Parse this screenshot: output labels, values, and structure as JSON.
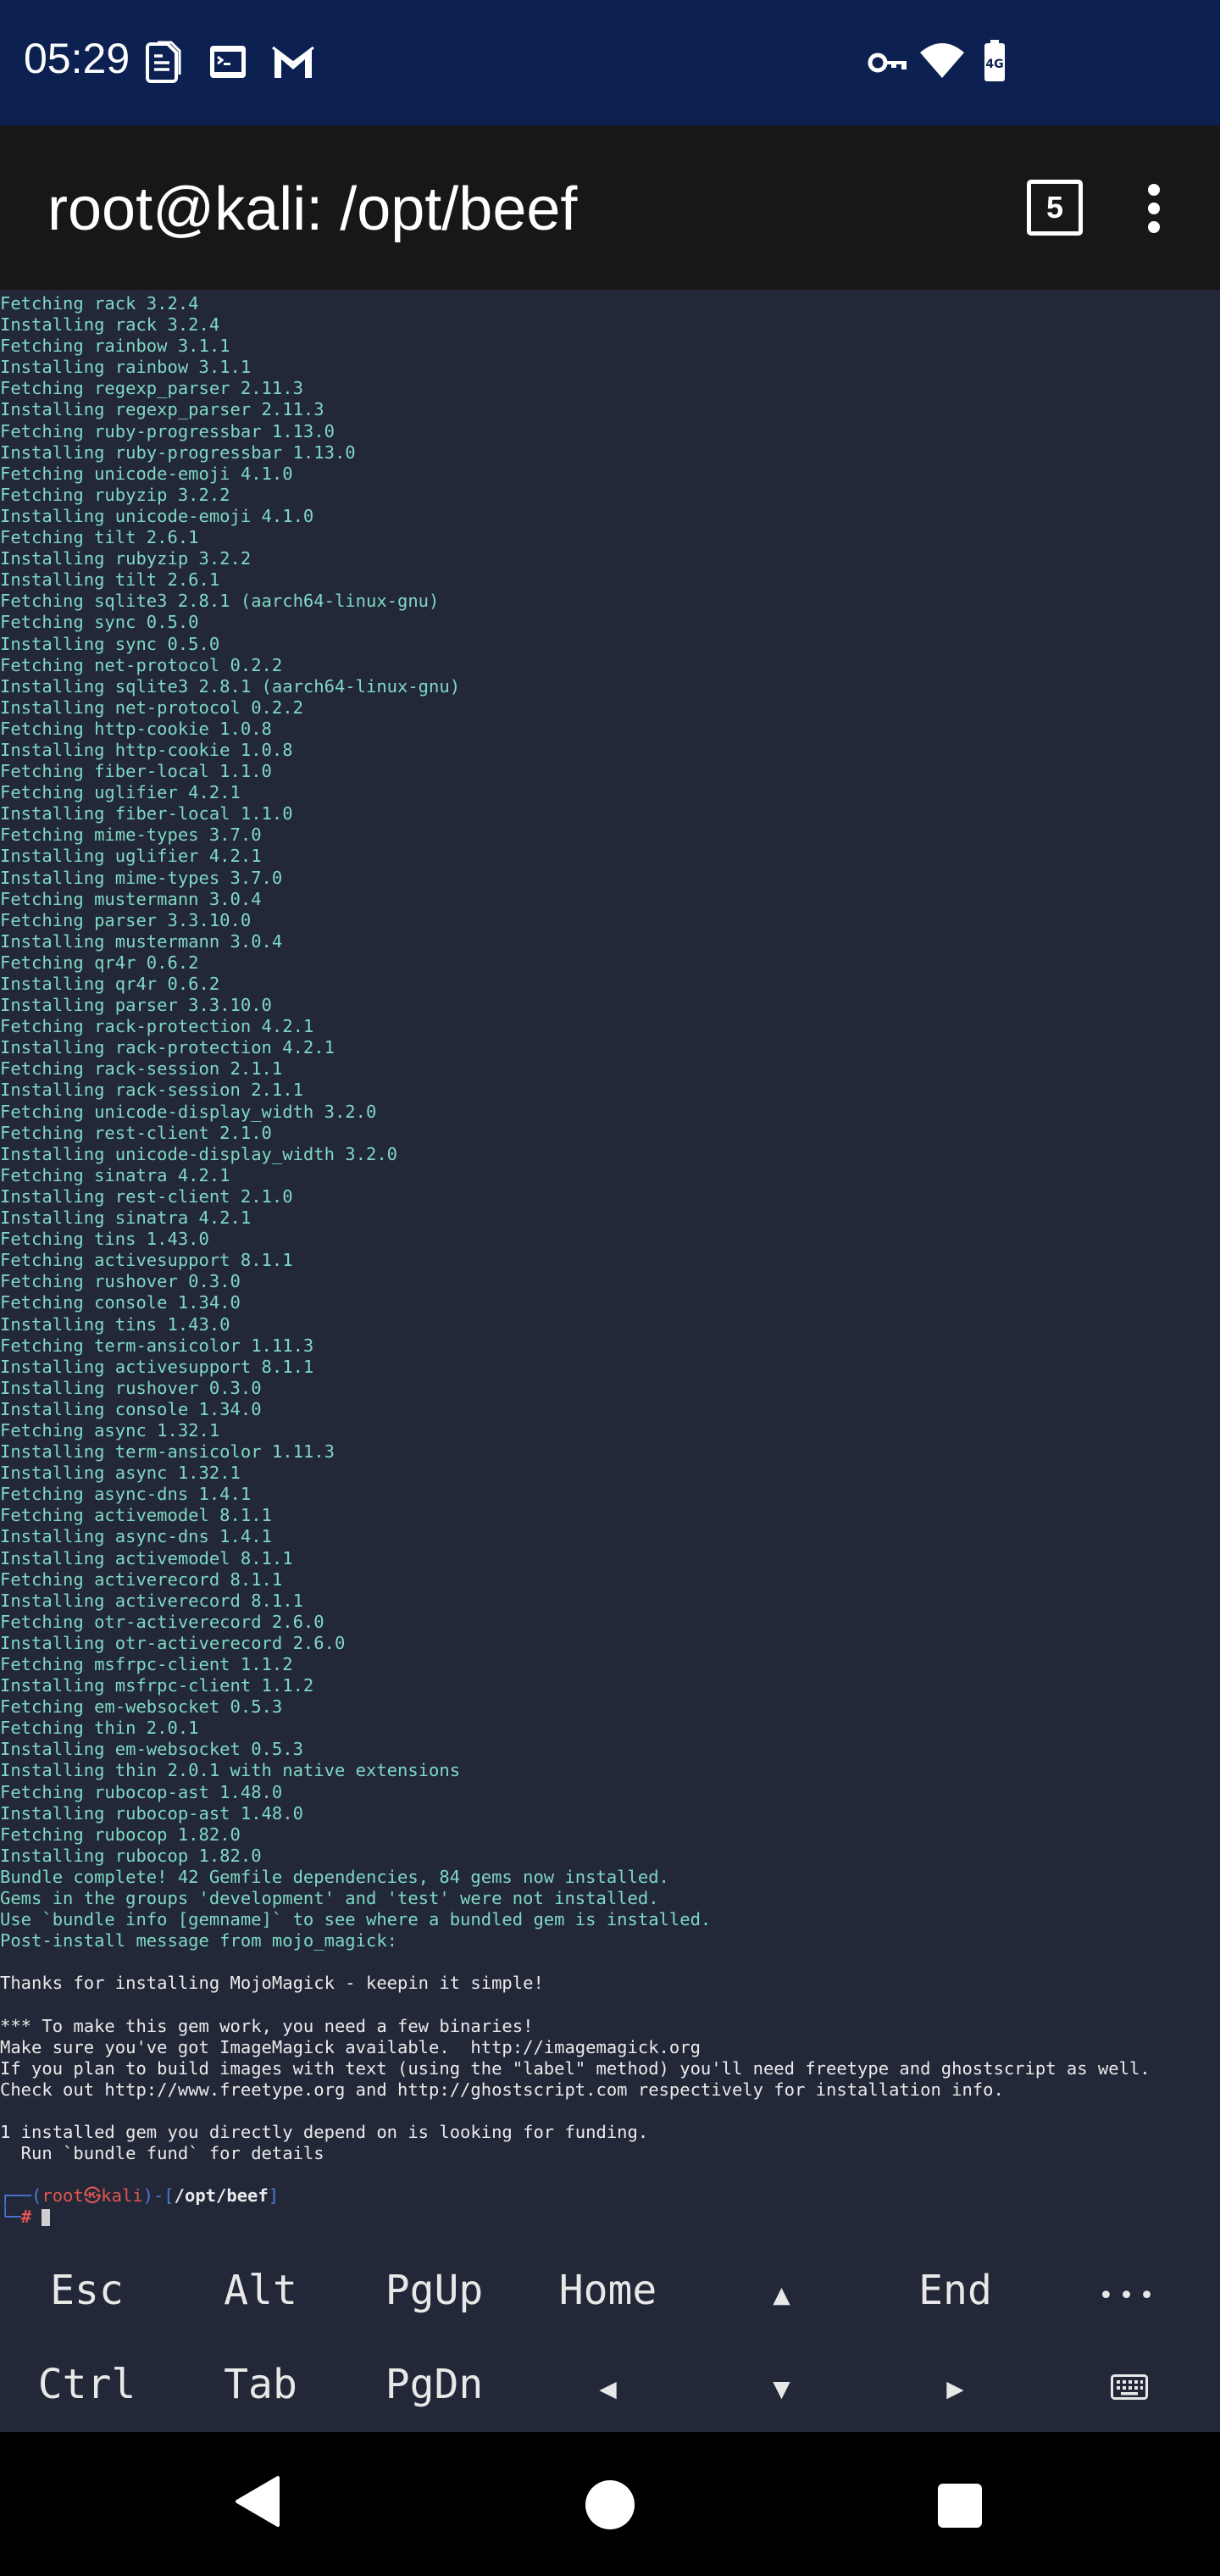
{
  "status_bar": {
    "time": "05:29",
    "icons": [
      "document-icon",
      "terminal-icon",
      "gmail-icon",
      "vpn-key-icon",
      "wifi-icon",
      "battery-icon"
    ]
  },
  "title_bar": {
    "title": "root@kali: /opt/beef",
    "session_count": "5",
    "menu_icon": "more-vert-icon"
  },
  "terminal": {
    "output_lines": [
      {
        "text": "Fetching rack 3.2.4",
        "style": "cyan"
      },
      {
        "text": "Installing rack 3.2.4",
        "style": "cyan"
      },
      {
        "text": "Fetching rainbow 3.1.1",
        "style": "cyan"
      },
      {
        "text": "Installing rainbow 3.1.1",
        "style": "cyan"
      },
      {
        "text": "Fetching regexp_parser 2.11.3",
        "style": "cyan"
      },
      {
        "text": "Installing regexp_parser 2.11.3",
        "style": "cyan"
      },
      {
        "text": "Fetching ruby-progressbar 1.13.0",
        "style": "cyan"
      },
      {
        "text": "Installing ruby-progressbar 1.13.0",
        "style": "cyan"
      },
      {
        "text": "Fetching unicode-emoji 4.1.0",
        "style": "cyan"
      },
      {
        "text": "Fetching rubyzip 3.2.2",
        "style": "cyan"
      },
      {
        "text": "Installing unicode-emoji 4.1.0",
        "style": "cyan"
      },
      {
        "text": "Fetching tilt 2.6.1",
        "style": "cyan"
      },
      {
        "text": "Installing rubyzip 3.2.2",
        "style": "cyan"
      },
      {
        "text": "Installing tilt 2.6.1",
        "style": "cyan"
      },
      {
        "text": "Fetching sqlite3 2.8.1 (aarch64-linux-gnu)",
        "style": "cyan"
      },
      {
        "text": "Fetching sync 0.5.0",
        "style": "cyan"
      },
      {
        "text": "Installing sync 0.5.0",
        "style": "cyan"
      },
      {
        "text": "Fetching net-protocol 0.2.2",
        "style": "cyan"
      },
      {
        "text": "Installing sqlite3 2.8.1 (aarch64-linux-gnu)",
        "style": "cyan"
      },
      {
        "text": "Installing net-protocol 0.2.2",
        "style": "cyan"
      },
      {
        "text": "Fetching http-cookie 1.0.8",
        "style": "cyan"
      },
      {
        "text": "Installing http-cookie 1.0.8",
        "style": "cyan"
      },
      {
        "text": "Fetching fiber-local 1.1.0",
        "style": "cyan"
      },
      {
        "text": "Fetching uglifier 4.2.1",
        "style": "cyan"
      },
      {
        "text": "Installing fiber-local 1.1.0",
        "style": "cyan"
      },
      {
        "text": "Fetching mime-types 3.7.0",
        "style": "cyan"
      },
      {
        "text": "Installing uglifier 4.2.1",
        "style": "cyan"
      },
      {
        "text": "Installing mime-types 3.7.0",
        "style": "cyan"
      },
      {
        "text": "Fetching mustermann 3.0.4",
        "style": "cyan"
      },
      {
        "text": "Fetching parser 3.3.10.0",
        "style": "cyan"
      },
      {
        "text": "Installing mustermann 3.0.4",
        "style": "cyan"
      },
      {
        "text": "Fetching qr4r 0.6.2",
        "style": "cyan"
      },
      {
        "text": "Installing qr4r 0.6.2",
        "style": "cyan"
      },
      {
        "text": "Installing parser 3.3.10.0",
        "style": "cyan"
      },
      {
        "text": "Fetching rack-protection 4.2.1",
        "style": "cyan"
      },
      {
        "text": "Installing rack-protection 4.2.1",
        "style": "cyan"
      },
      {
        "text": "Fetching rack-session 2.1.1",
        "style": "cyan"
      },
      {
        "text": "Installing rack-session 2.1.1",
        "style": "cyan"
      },
      {
        "text": "Fetching unicode-display_width 3.2.0",
        "style": "cyan"
      },
      {
        "text": "Fetching rest-client 2.1.0",
        "style": "cyan"
      },
      {
        "text": "Installing unicode-display_width 3.2.0",
        "style": "cyan"
      },
      {
        "text": "Fetching sinatra 4.2.1",
        "style": "cyan"
      },
      {
        "text": "Installing rest-client 2.1.0",
        "style": "cyan"
      },
      {
        "text": "Installing sinatra 4.2.1",
        "style": "cyan"
      },
      {
        "text": "Fetching tins 1.43.0",
        "style": "cyan"
      },
      {
        "text": "Fetching activesupport 8.1.1",
        "style": "cyan"
      },
      {
        "text": "Fetching rushover 0.3.0",
        "style": "cyan"
      },
      {
        "text": "Fetching console 1.34.0",
        "style": "cyan"
      },
      {
        "text": "Installing tins 1.43.0",
        "style": "cyan"
      },
      {
        "text": "Fetching term-ansicolor 1.11.3",
        "style": "cyan"
      },
      {
        "text": "Installing activesupport 8.1.1",
        "style": "cyan"
      },
      {
        "text": "Installing rushover 0.3.0",
        "style": "cyan"
      },
      {
        "text": "Installing console 1.34.0",
        "style": "cyan"
      },
      {
        "text": "Fetching async 1.32.1",
        "style": "cyan"
      },
      {
        "text": "Installing term-ansicolor 1.11.3",
        "style": "cyan"
      },
      {
        "text": "Installing async 1.32.1",
        "style": "cyan"
      },
      {
        "text": "Fetching async-dns 1.4.1",
        "style": "cyan"
      },
      {
        "text": "Fetching activemodel 8.1.1",
        "style": "cyan"
      },
      {
        "text": "Installing async-dns 1.4.1",
        "style": "cyan"
      },
      {
        "text": "Installing activemodel 8.1.1",
        "style": "cyan"
      },
      {
        "text": "Fetching activerecord 8.1.1",
        "style": "cyan"
      },
      {
        "text": "Installing activerecord 8.1.1",
        "style": "cyan"
      },
      {
        "text": "Fetching otr-activerecord 2.6.0",
        "style": "cyan"
      },
      {
        "text": "Installing otr-activerecord 2.6.0",
        "style": "cyan"
      },
      {
        "text": "Fetching msfrpc-client 1.1.2",
        "style": "cyan"
      },
      {
        "text": "Installing msfrpc-client 1.1.2",
        "style": "cyan"
      },
      {
        "text": "Fetching em-websocket 0.5.3",
        "style": "cyan"
      },
      {
        "text": "Fetching thin 2.0.1",
        "style": "cyan"
      },
      {
        "text": "Installing em-websocket 0.5.3",
        "style": "cyan"
      },
      {
        "text": "Installing thin 2.0.1 with native extensions",
        "style": "cyan"
      },
      {
        "text": "Fetching rubocop-ast 1.48.0",
        "style": "cyan"
      },
      {
        "text": "Installing rubocop-ast 1.48.0",
        "style": "cyan"
      },
      {
        "text": "Fetching rubocop 1.82.0",
        "style": "cyan"
      },
      {
        "text": "Installing rubocop 1.82.0",
        "style": "cyan"
      },
      {
        "text": "Bundle complete! 42 Gemfile dependencies, 84 gems now installed.",
        "style": "cyan"
      },
      {
        "text": "Gems in the groups 'development' and 'test' were not installed.",
        "style": "cyan"
      },
      {
        "text": "Use `bundle info [gemname]` to see where a bundled gem is installed.",
        "style": "cyan"
      },
      {
        "text": "Post-install message from mojo_magick:",
        "style": "cyan"
      },
      {
        "text": "",
        "style": "white"
      },
      {
        "text": "Thanks for installing MojoMagick - keepin it simple!",
        "style": "white"
      },
      {
        "text": "",
        "style": "white"
      },
      {
        "text": "*** To make this gem work, you need a few binaries!",
        "style": "white"
      },
      {
        "text": "Make sure you've got ImageMagick available.  http://imagemagick.org",
        "style": "white"
      },
      {
        "text": "If you plan to build images with text (using the \"label\" method) you'll need freetype and ghostscript as well.",
        "style": "white"
      },
      {
        "text": "Check out http://www.freetype.org and http://ghostscript.com respectively for installation info.",
        "style": "white"
      },
      {
        "text": "",
        "style": "white"
      },
      {
        "text": "1 installed gem you directly depend on is looking for funding.",
        "style": "white"
      },
      {
        "text": "  Run `bundle fund` for details",
        "style": "white"
      },
      {
        "text": "",
        "style": "white"
      }
    ],
    "prompt": {
      "corner_top": "┌──(",
      "user": "root",
      "at_symbol": "㉿",
      "host": "kali",
      "sep": ")-[",
      "path": "/opt/beef",
      "close": "]",
      "corner_bottom": "└─",
      "symbol": "#"
    }
  },
  "extra_keys": {
    "row1": [
      {
        "label": "Esc",
        "name": "key-esc"
      },
      {
        "label": "Alt",
        "name": "key-alt"
      },
      {
        "label": "PgUp",
        "name": "key-pgup"
      },
      {
        "label": "Home",
        "name": "key-home"
      },
      {
        "label": "▲",
        "name": "key-arrow-up"
      },
      {
        "label": "End",
        "name": "key-end"
      },
      {
        "label": "•••",
        "name": "key-more"
      }
    ],
    "row2": [
      {
        "label": "Ctrl",
        "name": "key-ctrl"
      },
      {
        "label": "Tab",
        "name": "key-tab"
      },
      {
        "label": "PgDn",
        "name": "key-pgdn"
      },
      {
        "label": "◀",
        "name": "key-arrow-left"
      },
      {
        "label": "▼",
        "name": "key-arrow-down"
      },
      {
        "label": "▶",
        "name": "key-arrow-right"
      },
      {
        "label": "",
        "name": "key-keyboard",
        "icon": "keyboard-icon"
      }
    ]
  },
  "nav_bar": {
    "buttons": [
      "back-triangle-icon",
      "home-circle-icon",
      "recents-square-icon"
    ]
  },
  "colors": {
    "status_bar_bg": "#0c2152",
    "title_bar_bg": "#171717",
    "terminal_bg": "#222838",
    "output_cyan": "#7fd8c5",
    "output_white": "#eaeaea",
    "prompt_blue": "#4d78d8",
    "prompt_red": "#e0554f"
  }
}
